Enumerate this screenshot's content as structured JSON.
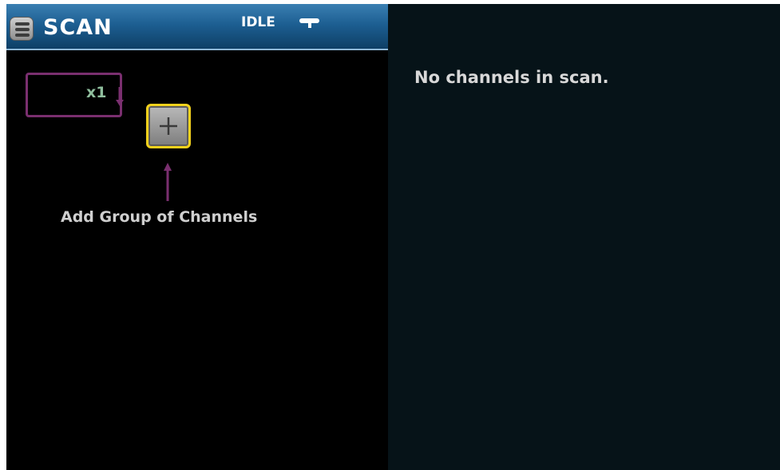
{
  "header": {
    "title": "SCAN",
    "status": "IDLE",
    "menu_icon": "hamburger-menu-icon",
    "status_icon": "trigger-pointer-icon"
  },
  "scan_builder": {
    "group_count": "x1",
    "add_button_icon": "plus-icon",
    "add_group_label": "Add Group of Channels"
  },
  "channel_list": {
    "empty_message": "No channels in scan."
  },
  "colors": {
    "header_blue": "#1d5f92",
    "group_border": "#7a2f6f",
    "focus_yellow": "#f3d11c",
    "count_green": "#8fbe9d",
    "right_panel_bg": "#061318"
  }
}
